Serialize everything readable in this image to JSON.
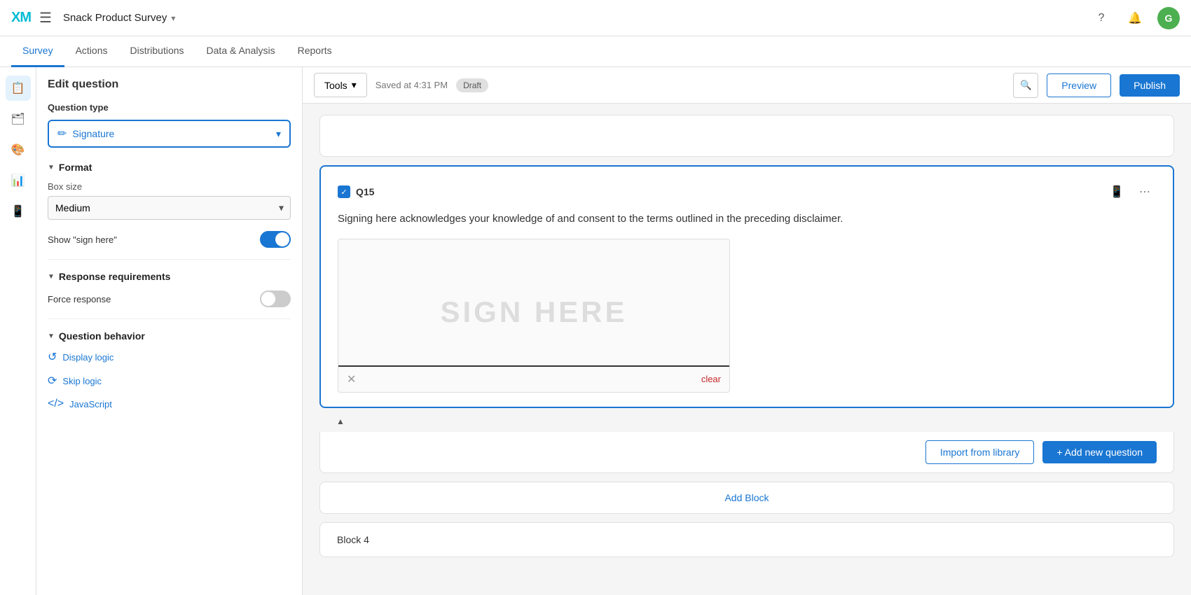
{
  "app": {
    "logo": "XM",
    "title": "Snack Product Survey",
    "title_caret": "▾"
  },
  "top_nav": {
    "icons": {
      "help": "?",
      "bell": "🔔",
      "user": "G"
    }
  },
  "sub_nav": {
    "items": [
      "Survey",
      "Actions",
      "Distributions",
      "Data & Analysis",
      "Reports"
    ],
    "active": "Survey"
  },
  "toolbar": {
    "tools_label": "Tools",
    "tools_caret": "▾",
    "saved_text": "Saved at 4:31 PM",
    "draft_label": "Draft",
    "search_icon": "🔍",
    "preview_label": "Preview",
    "publish_label": "Publish"
  },
  "sidebar": {
    "title": "Edit question",
    "question_type_label": "Question type",
    "question_type_icon": "✏",
    "question_type_value": "Signature",
    "question_type_caret": "▾",
    "format_section": "Format",
    "box_size_label": "Box size",
    "box_size_value": "Medium",
    "show_sign_here_label": "Show \"sign here\"",
    "show_sign_here_on": true,
    "response_requirements_section": "Response requirements",
    "force_response_label": "Force response",
    "force_response_on": false,
    "question_behavior_section": "Question behavior",
    "display_logic_label": "Display logic",
    "skip_logic_label": "Skip logic",
    "javascript_label": "JavaScript"
  },
  "question": {
    "id": "Q15",
    "text": "Signing here acknowledges your knowledge of and consent to the terms outlined in the preceding disclaimer.",
    "sign_here_text": "SIGN HERE",
    "clear_label": "clear"
  },
  "footer": {
    "import_label": "Import from library",
    "add_label": "+ Add new question"
  },
  "add_block": {
    "label": "Add Block"
  },
  "icon_bar": {
    "items": [
      "📋",
      "🗂",
      "🎨",
      "📊",
      "📱"
    ]
  }
}
